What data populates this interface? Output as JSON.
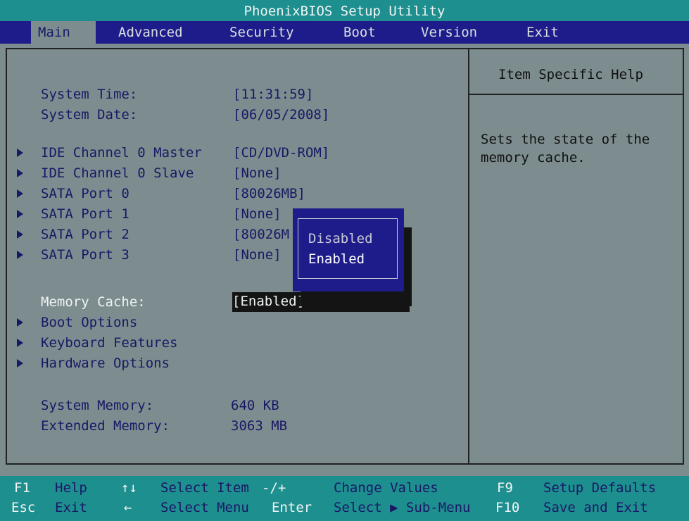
{
  "title": "PhoenixBIOS Setup Utility",
  "tabs": [
    {
      "label": "Main",
      "active": true
    },
    {
      "label": "Advanced"
    },
    {
      "label": "Security"
    },
    {
      "label": "Boot"
    },
    {
      "label": "Version"
    },
    {
      "label": "Exit"
    }
  ],
  "main": {
    "system_time_label": "System Time:",
    "system_time_value": "[11:31:59]",
    "system_date_label": "System Date:",
    "system_date_value": "[06/05/2008]",
    "ide_master_label": "IDE Channel 0 Master",
    "ide_master_value": "[CD/DVD-ROM]",
    "ide_slave_label": "IDE Channel 0 Slave",
    "ide_slave_value": "[None]",
    "sata0_label": "SATA Port 0",
    "sata0_value": "[80026MB]",
    "sata1_label": "SATA Port 1",
    "sata1_value": "[None]",
    "sata2_label": "SATA Port 2",
    "sata2_value": "[80026M",
    "sata3_label": "SATA Port 3",
    "sata3_value": "[None]",
    "memory_cache_label": "Memory Cache:",
    "memory_cache_value": "[Enabled]",
    "boot_options_label": "Boot Options",
    "keyboard_features_label": "Keyboard Features",
    "hardware_options_label": "Hardware Options",
    "system_memory_label": "System Memory:",
    "system_memory_value": "640 KB",
    "extended_memory_label": "Extended Memory:",
    "extended_memory_value": "3063 MB"
  },
  "popup": {
    "options": [
      "Disabled",
      "Enabled"
    ],
    "selected": "Enabled"
  },
  "help": {
    "title": "Item Specific Help",
    "text": "Sets the state of the\nmemory cache."
  },
  "footer": {
    "f1_key": "F1",
    "f1_desc": "Help",
    "updown_key": "↑↓",
    "updown_desc": "Select Item",
    "pm_key": "-/+",
    "pm_desc": "Change Values",
    "f9_key": "F9",
    "f9_desc": "Setup Defaults",
    "esc_key": "Esc",
    "esc_desc": "Exit",
    "lr_key": "←",
    "lr_desc": "Select Menu",
    "enter_key": "Enter",
    "enter_desc": "Select ▶ Sub-Menu",
    "f10_key": "F10",
    "f10_desc": "Save and Exit"
  },
  "colors": {
    "background": "#7d8d8f",
    "title_bar": "#1e8f8f",
    "menu_bar": "#1e1c8a",
    "text_blue": "#1a1866",
    "highlight": "#eef2f2"
  }
}
